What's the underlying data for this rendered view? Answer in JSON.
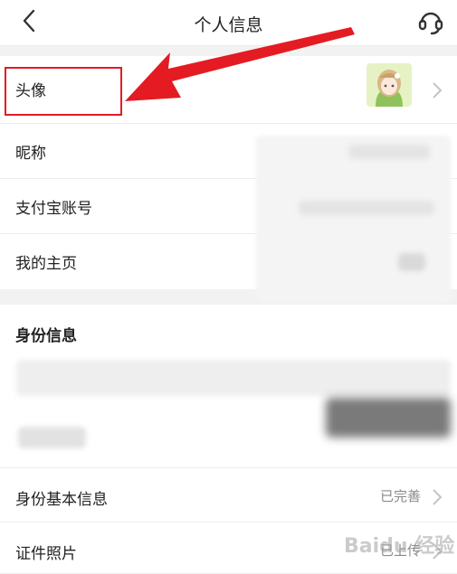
{
  "header": {
    "title": "个人信息"
  },
  "profile": {
    "avatar_label": "头像",
    "nickname_label": "昵称",
    "alipay_label": "支付宝账号",
    "homepage_label": "我的主页"
  },
  "identity": {
    "section_title": "身份信息",
    "basic_info_label": "身份基本信息",
    "basic_info_status": "已完善",
    "id_photo_label": "证件照片",
    "id_photo_status": "已上传"
  },
  "watermark": "Baidu 经验",
  "colors": {
    "highlight": "#e41b23",
    "background": "#f2f2f2"
  }
}
